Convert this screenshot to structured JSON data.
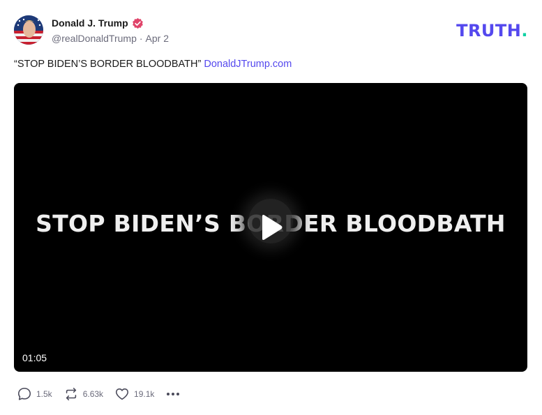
{
  "post": {
    "author_name": "Donald J. Trump",
    "handle": "@realDonaldTrump",
    "separator": "·",
    "date": "Apr 2",
    "text": "“STOP BIDEN’S BORDER BLOODBATH”",
    "link_text": "DonaldJTrump.com"
  },
  "brand": {
    "logo_text": "TRUTH",
    "logo_dot": ".",
    "primary_color": "#5448ee",
    "accent_color": "#0fd1a3"
  },
  "video": {
    "overlay_text": "STOP BIDEN’S BORDER BLOODBATH",
    "duration": "01:05"
  },
  "actions": {
    "replies": "1.5k",
    "retruths": "6.63k",
    "likes": "19.1k"
  },
  "icons": {
    "verified": "verified-badge-icon",
    "reply": "reply-bubble-icon",
    "retruth": "retruth-arrows-icon",
    "like": "heart-icon",
    "more": "more-dots-icon",
    "play": "play-icon"
  }
}
